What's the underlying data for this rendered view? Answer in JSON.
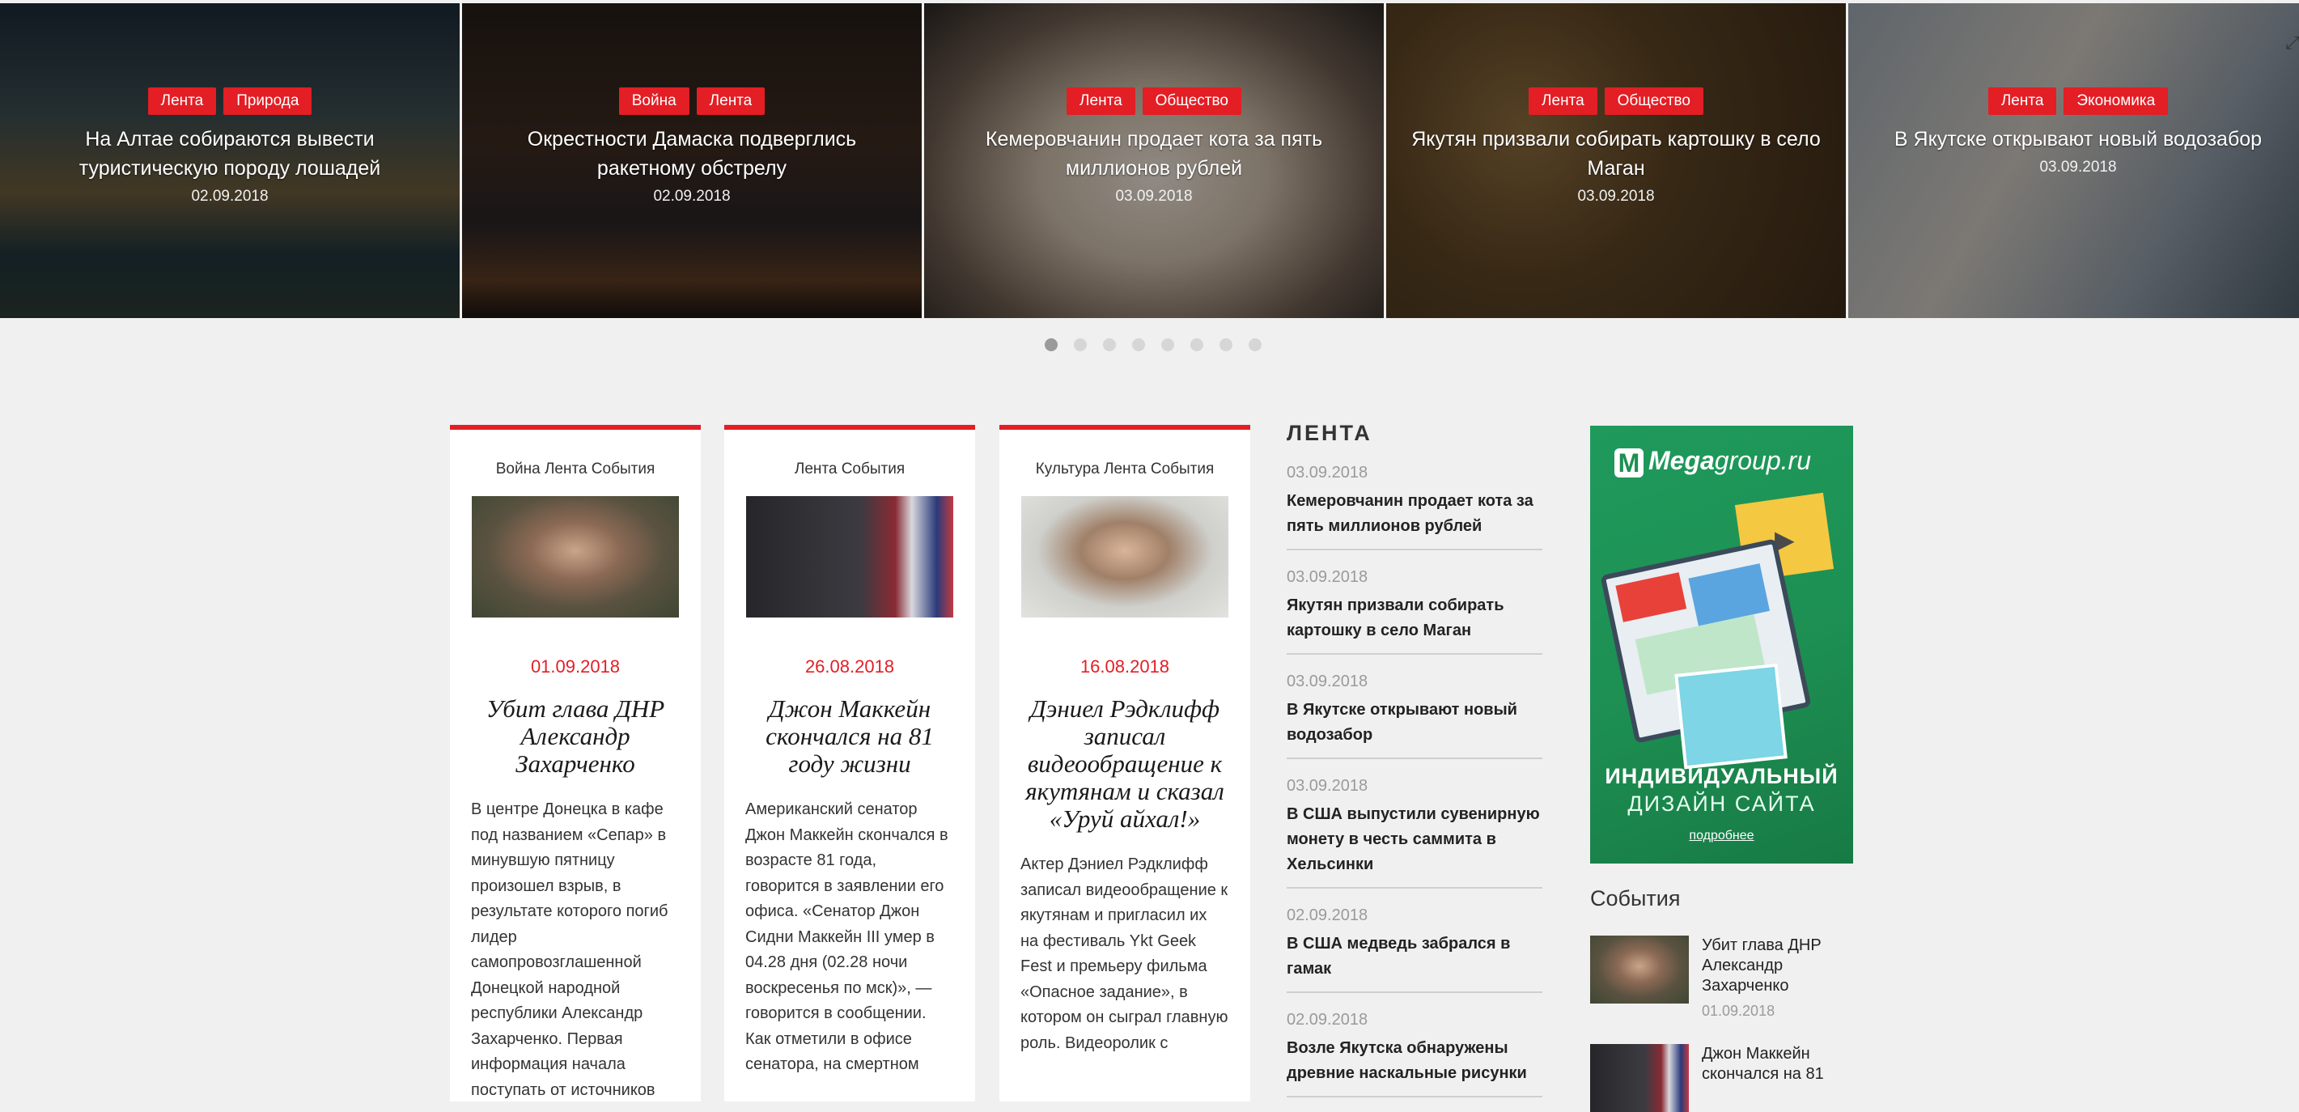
{
  "slider": {
    "slides": [
      {
        "tags": [
          "Лента",
          "Природа"
        ],
        "title": "На Алтае собираются вывести туристическую породу лошадей",
        "date": "02.09.2018"
      },
      {
        "tags": [
          "Война",
          "Лента"
        ],
        "title": "Окрестности Дамаска подверглись ракетному обстрелу",
        "date": "02.09.2018"
      },
      {
        "tags": [
          "Лента",
          "Общество"
        ],
        "title": "Кемеровчанин продает кота за пять миллионов рублей",
        "date": "03.09.2018"
      },
      {
        "tags": [
          "Лента",
          "Общество"
        ],
        "title": "Якутян призвали собирать картошку в село Маган",
        "date": "03.09.2018"
      },
      {
        "tags": [
          "Лента",
          "Экономика"
        ],
        "title": "В Якутске открывают новый водозабор",
        "date": "03.09.2018"
      }
    ],
    "dots_count": 8,
    "active_dot": 0,
    "corner_icon": "expand-icon"
  },
  "cards": [
    {
      "categories": "Война Лента События",
      "date": "01.09.2018",
      "title": "Убит глава ДНР Александр Захарченко",
      "text": "В центре Донецка в кафе под названием «Сепар» в минувшую пятницу произошел взрыв, в результате которого погиб лидер самопровозглашенной Донецкой народной республики Александр Захарченко. Первая информация начала поступать от источников"
    },
    {
      "categories": "Лента События",
      "date": "26.08.2018",
      "title": "Джон Маккейн скончался на 81 году жизни",
      "text": "Американский сенатор Джон Маккейн скончался в возрасте 81 года, говорится в заявлении его офиса. «Сенатор Джон Сидни Маккейн III умер в 04.28 дня (02.28 ночи воскресенья по мск)», — говорится в сообщении. Как отметили в офисе сенатора, на смертном"
    },
    {
      "categories": "Культура Лента События",
      "date": "16.08.2018",
      "title": "Дэниел Рэдклифф записал видеообращение к якутянам и сказал «Уруй айхал!»",
      "text": "Актер Дэниел Рэдклифф записал видеообращение к якутянам и пригласил их на фестиваль Ykt Geek Fest и премьеру фильма «Опасное задание», в котором он сыграл главную роль. Видеоролик с"
    }
  ],
  "lenta": {
    "heading": "ЛЕНТА",
    "items": [
      {
        "date": "03.09.2018",
        "title": "Кемеровчанин продает кота за пять миллионов рублей"
      },
      {
        "date": "03.09.2018",
        "title": "Якутян призвали собирать картошку в село Маган"
      },
      {
        "date": "03.09.2018",
        "title": "В Якутске открывают новый водозабор"
      },
      {
        "date": "03.09.2018",
        "title": "В США выпустили сувенирную монету в честь саммита в Хельсинки"
      },
      {
        "date": "02.09.2018",
        "title": "В США медведь забрался в гамак"
      },
      {
        "date": "02.09.2018",
        "title": "Возле Якутска обнаружены древние наскальные рисунки"
      }
    ]
  },
  "ad": {
    "brand_main": "Mega",
    "brand_rest": "group.ru",
    "line1": "ИНДИВИДУАЛЬНЫЙ",
    "line2": "ДИЗАЙН САЙТА",
    "more": "подробнее"
  },
  "events": {
    "heading": "События",
    "items": [
      {
        "title": "Убит глава ДНР Александр Захарченко",
        "date": "01.09.2018"
      },
      {
        "title": "Джон Маккейн скончался на 81",
        "date": ""
      }
    ]
  },
  "colors": {
    "accent": "#e31e24",
    "background": "#f0f0f0",
    "ad_green": "#1d8f52"
  }
}
